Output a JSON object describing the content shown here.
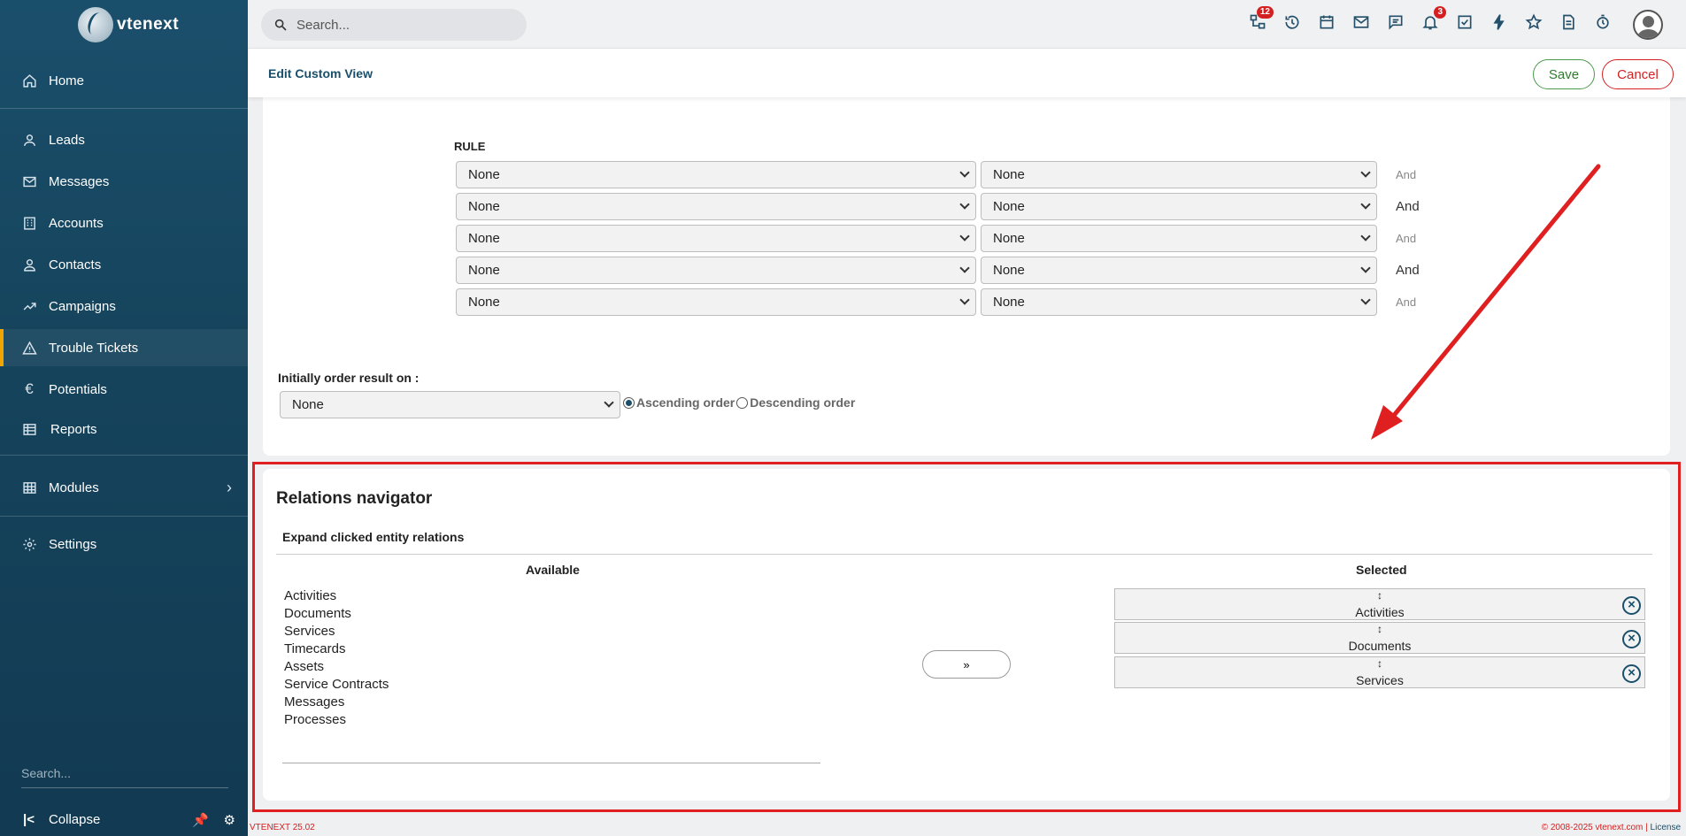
{
  "app": {
    "logo_text": "vtenext"
  },
  "sidebar": {
    "items": [
      {
        "label": "Home",
        "icon": "home-icon"
      },
      {
        "label": "Leads",
        "icon": "user-icon"
      },
      {
        "label": "Messages",
        "icon": "mail-icon"
      },
      {
        "label": "Accounts",
        "icon": "building-icon"
      },
      {
        "label": "Contacts",
        "icon": "person-icon"
      },
      {
        "label": "Campaigns",
        "icon": "trend-icon"
      },
      {
        "label": "Trouble Tickets",
        "icon": "warning-icon",
        "active": true
      },
      {
        "label": "Potentials",
        "icon": "euro-icon"
      },
      {
        "label": "Reports",
        "icon": "table-icon"
      },
      {
        "label": "Modules",
        "icon": "grid-icon"
      },
      {
        "label": "Settings",
        "icon": "gear-icon"
      }
    ],
    "search_placeholder": "Search...",
    "collapse_label": "Collapse"
  },
  "topbar": {
    "search_placeholder": "Search...",
    "icons": [
      {
        "name": "processes-icon",
        "badge": "12"
      },
      {
        "name": "history-icon",
        "badge": ""
      },
      {
        "name": "calendar-icon",
        "badge": ""
      },
      {
        "name": "mail-icon",
        "badge": ""
      },
      {
        "name": "chat-icon",
        "badge": ""
      },
      {
        "name": "bell-icon",
        "badge": "3"
      },
      {
        "name": "tasks-icon",
        "badge": ""
      },
      {
        "name": "bolt-icon",
        "badge": ""
      },
      {
        "name": "star-icon",
        "badge": ""
      },
      {
        "name": "document-icon",
        "badge": ""
      },
      {
        "name": "timer-icon",
        "badge": ""
      }
    ]
  },
  "header": {
    "title": "Edit Custom View",
    "save_label": "Save",
    "cancel_label": "Cancel"
  },
  "rules": {
    "label": "RULE",
    "rows": [
      {
        "field": "None",
        "op": "None",
        "conj": "And"
      },
      {
        "field": "None",
        "op": "None",
        "conj": "And"
      },
      {
        "field": "None",
        "op": "None",
        "conj": "And"
      },
      {
        "field": "None",
        "op": "None",
        "conj": "And"
      },
      {
        "field": "None",
        "op": "None",
        "conj": "And"
      }
    ]
  },
  "order": {
    "label": "Initially order result on :",
    "value": "None",
    "asc_label": "Ascending order",
    "desc_label": "Descending order"
  },
  "relations": {
    "title": "Relations navigator",
    "subtitle": "Expand clicked entity relations",
    "available_header": "Available",
    "selected_header": "Selected",
    "available": [
      "Activities",
      "Documents",
      "Services",
      "Timecards",
      "Assets",
      "Service Contracts",
      "Messages",
      "Processes"
    ],
    "move_label": "»",
    "selected": [
      "Activities",
      "Documents",
      "Services"
    ],
    "drag_glyph": "↕"
  },
  "footer": {
    "version": "VTENEXT 25.02",
    "copyright": "© 2008-2025 vtenext.com | ",
    "license": "License"
  },
  "colors": {
    "sidebar": "#1a4f6b",
    "accent": "#f0a500",
    "danger": "#d42020",
    "success": "#4a9a4a"
  }
}
